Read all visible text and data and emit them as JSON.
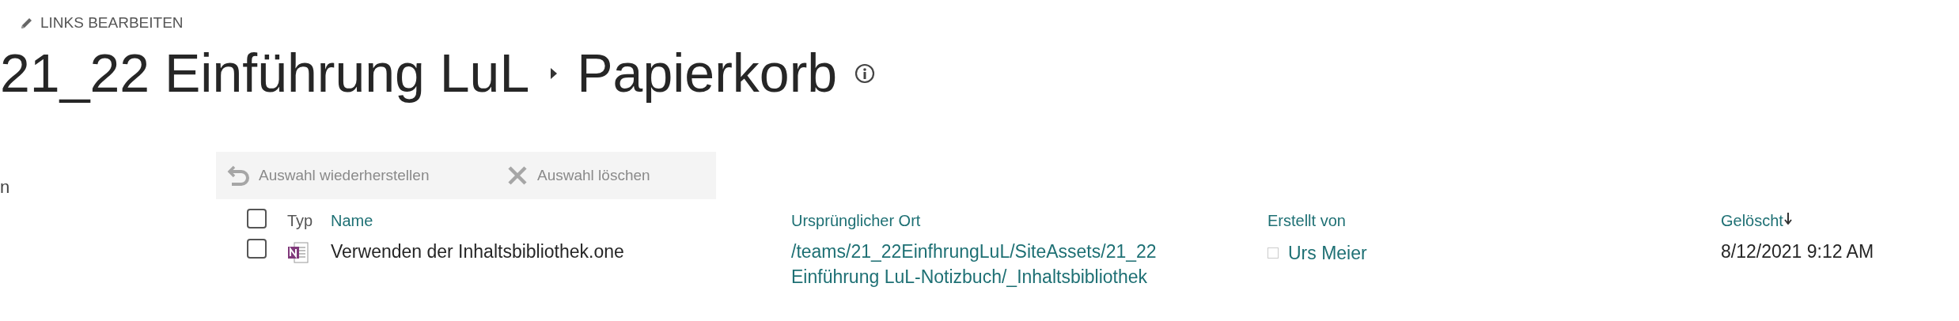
{
  "edit_links": {
    "label": "LINKS BEARBEITEN"
  },
  "breadcrumb": [
    {
      "label": "21_22 Einführung LuL"
    },
    {
      "label": "Papierkorb"
    }
  ],
  "sidebar": {
    "fragment": "n"
  },
  "toolbar": [
    {
      "kind": "restore",
      "label": "Auswahl wiederherstellen",
      "disabled": true
    },
    {
      "kind": "delete",
      "label": "Auswahl löschen",
      "disabled": true
    }
  ],
  "table": {
    "select_all": {
      "checked": false
    },
    "columns": [
      {
        "label": "Typ",
        "sortable": false,
        "sorted": false
      },
      {
        "label": "Name",
        "sortable": true,
        "sorted": false
      },
      {
        "label": "Ursprünglicher Ort",
        "sortable": true,
        "sorted": false
      },
      {
        "label": "Erstellt von",
        "sortable": true,
        "sorted": false
      },
      {
        "label": "Gelöscht",
        "sortable": true,
        "sorted": true
      }
    ],
    "rows": [
      {
        "selected": false,
        "name": "Verwenden der Inhaltsbibliothek.one",
        "original_location": "/teams/21_22EinfhrungLuL/SiteAssets/21_22 Einführung LuL-Notizbuch/_Inhaltsbibliothek",
        "created_by": "Urs Meier",
        "deleted": "8/12/2021 9:12 AM"
      }
    ]
  }
}
